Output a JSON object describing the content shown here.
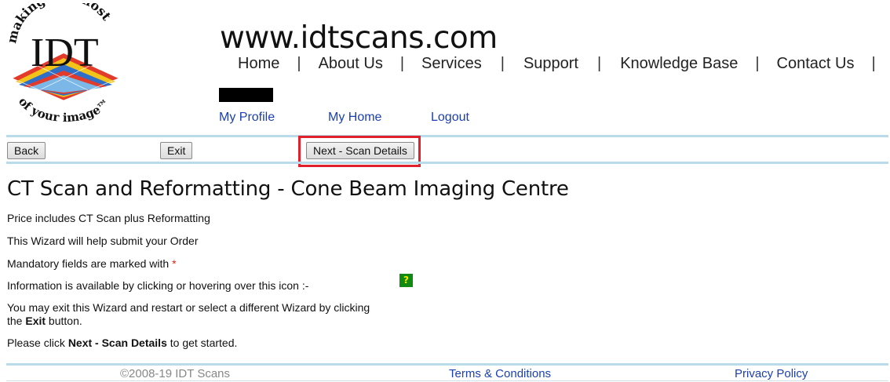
{
  "header": {
    "logo": {
      "top_text": "making the most",
      "brand": "IDT",
      "bottom_text": "of your image™"
    },
    "site_url": "www.idtscans.com",
    "nav": [
      "Home",
      "About Us",
      "Services",
      "Support",
      "Knowledge Base",
      "Contact Us"
    ],
    "nav_separator": "|",
    "user_links": [
      "My Profile",
      "My Home",
      "Logout"
    ]
  },
  "toolbar": {
    "back_label": "Back",
    "exit_label": "Exit",
    "next_label": "Next - Scan Details"
  },
  "main": {
    "title": "CT Scan and Reformatting - Cone Beam Imaging Centre",
    "lines": {
      "price": "Price includes CT Scan plus Reformatting",
      "wizard": "This Wizard will help submit your Order",
      "mandatory": "Mandatory fields are marked with ",
      "mandatory_marker": "*",
      "info": "Information is available by clicking or hovering over this icon :-",
      "info_icon_glyph": "?",
      "exit_1": "You may exit this Wizard and restart or select a different Wizard by clicking",
      "exit_2_pre": "the ",
      "exit_2_bold": "Exit",
      "exit_2_post": " button.",
      "start_pre": "Please click ",
      "start_bold": "Next - Scan Details",
      "start_post": " to get started."
    }
  },
  "footer": {
    "copyright": "©2008-19 IDT Scans",
    "terms": "Terms & Conditions",
    "privacy": "Privacy Policy"
  },
  "colors": {
    "link": "#1b3fb0",
    "divider": "#b9dbea",
    "highlight_border": "#e0202a",
    "info_icon_bg": "#118a11"
  }
}
